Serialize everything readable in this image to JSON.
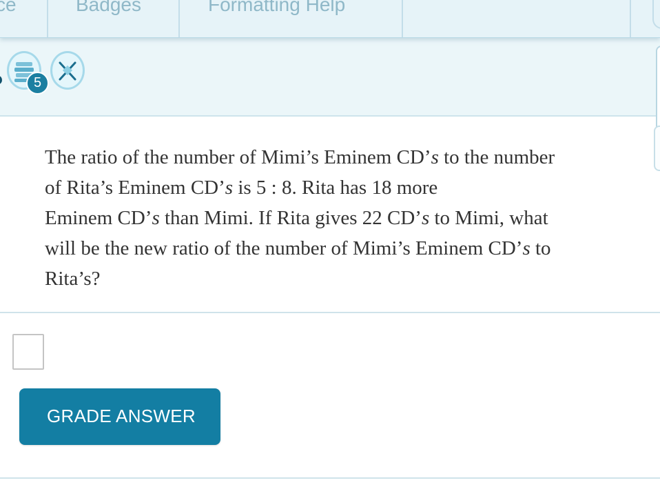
{
  "tabs": {
    "practice_label": "ce",
    "badges_label": "Badges",
    "formatting_help_label": "Formatting Help"
  },
  "badges": {
    "count": "5",
    "icons": [
      "books-badge-icon",
      "tools-badge-icon"
    ]
  },
  "question": {
    "line1_a": "The ratio of the number of Mimi’s Eminem CD’",
    "line1_s": "s",
    "line1_b": " to the number",
    "line2_a": "of Rita’s Eminem CD’",
    "line2_s": "s",
    "line2_b": " is 5 : 8. Rita has 18 more",
    "line3_a": "Eminem CD’",
    "line3_s": "s",
    "line3_b": "  than Mimi. If Rita gives 22 CD’",
    "line3_s2": "s",
    "line3_c": " to Mimi, what",
    "line4_a": "will be the new ratio of the number of Mimi’s Eminem CD’",
    "line4_s": "s",
    "line4_b": " to",
    "line5": "Rita’s?"
  },
  "answer": {
    "value": ""
  },
  "actions": {
    "grade_label": "GRADE ANSWER"
  },
  "colors": {
    "accent": "#137ea3",
    "tab_bar": "#e6f3f8",
    "badge_row": "#ebf6f9",
    "text": "#333333"
  }
}
